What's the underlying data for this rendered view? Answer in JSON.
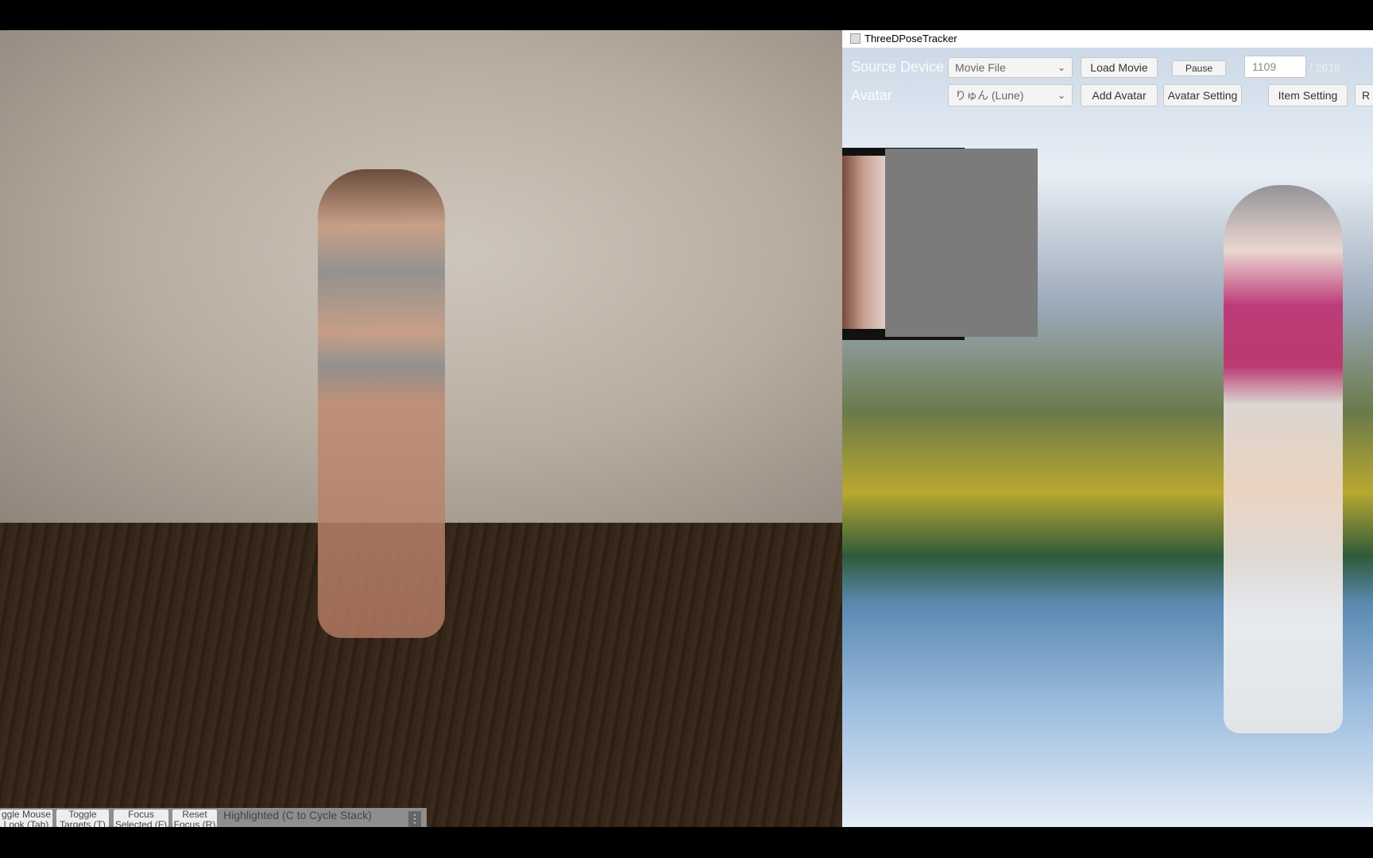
{
  "window": {
    "title": "ThreeDPoseTracker"
  },
  "toolbar": {
    "source_label": "Source Device",
    "source_value": "Movie File",
    "load_movie": "Load Movie",
    "pause": "Pause",
    "frame": "1109",
    "frame_total": "/ 2618",
    "avatar_label": "Avatar",
    "avatar_value": "りゅん (Lune)",
    "add_avatar": "Add Avatar",
    "avatar_setting": "Avatar Setting",
    "item_setting": "Item Setting",
    "r_button": "R"
  },
  "bottom": {
    "buttons": [
      {
        "line1": "ggle Mouse",
        "line2": "Look (Tab)"
      },
      {
        "line1": "Toggle",
        "line2": "Targets (T)"
      },
      {
        "line1": "Focus",
        "line2": "Selected (F)"
      },
      {
        "line1": "Reset",
        "line2": "Focus (R)"
      }
    ],
    "highlighted": "Highlighted (C to Cycle Stack)",
    "menu_icon": "⋮"
  }
}
